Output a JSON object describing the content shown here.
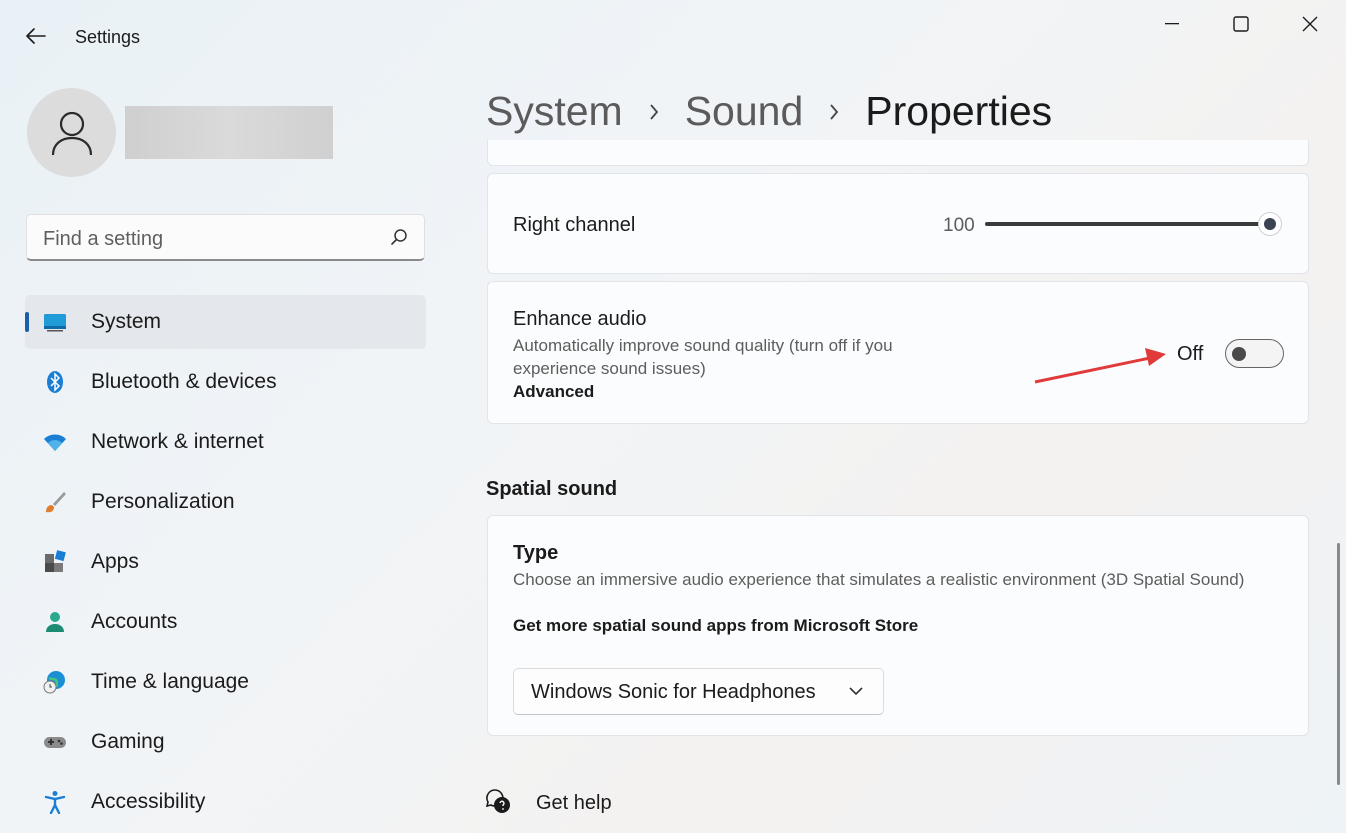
{
  "window": {
    "title": "Settings"
  },
  "search": {
    "placeholder": "Find a setting"
  },
  "nav": {
    "items": [
      {
        "label": "System",
        "icon": "monitor-icon",
        "selected": true
      },
      {
        "label": "Bluetooth & devices",
        "icon": "bluetooth-icon"
      },
      {
        "label": "Network & internet",
        "icon": "wifi-icon"
      },
      {
        "label": "Personalization",
        "icon": "brush-icon"
      },
      {
        "label": "Apps",
        "icon": "apps-icon"
      },
      {
        "label": "Accounts",
        "icon": "person-icon"
      },
      {
        "label": "Time & language",
        "icon": "globe-clock-icon"
      },
      {
        "label": "Gaming",
        "icon": "gamepad-icon"
      },
      {
        "label": "Accessibility",
        "icon": "accessibility-icon"
      }
    ]
  },
  "breadcrumb": {
    "system": "System",
    "sound": "Sound",
    "current": "Properties"
  },
  "right_channel": {
    "label": "Right channel",
    "value": "100",
    "level": 1.0
  },
  "enhance_audio": {
    "title": "Enhance audio",
    "description": "Automatically improve sound quality (turn off if you experience sound issues)",
    "link": "Advanced",
    "state_label": "Off",
    "on": false
  },
  "spatial": {
    "heading": "Spatial sound",
    "type_title": "Type",
    "description": "Choose an immersive audio experience that simulates a realistic environment (3D Spatial Sound)",
    "store_link": "Get more spatial sound apps from Microsoft Store",
    "selected": "Windows Sonic for Headphones"
  },
  "help": {
    "label": "Get help"
  },
  "colors": {
    "accent": "#1b5fa8",
    "annotation_arrow": "#e03a3a"
  }
}
